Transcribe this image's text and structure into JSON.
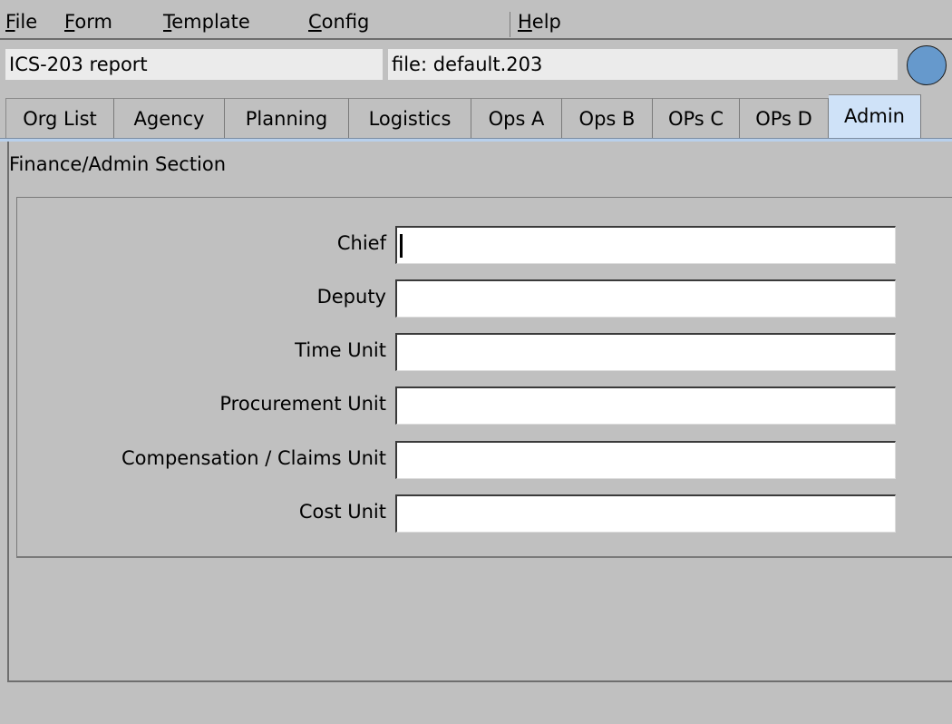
{
  "menubar": {
    "items": [
      {
        "mnemonic": "F",
        "rest": "ile"
      },
      {
        "mnemonic": "F",
        "rest": "orm"
      },
      {
        "mnemonic": "T",
        "rest": "emplate"
      },
      {
        "mnemonic": "C",
        "rest": "onfig"
      },
      {
        "mnemonic": "H",
        "rest": "elp"
      }
    ]
  },
  "header": {
    "report_name": "ICS-203 report",
    "file_label": "file: default.203",
    "status_color": "#6699cc"
  },
  "tabs": [
    {
      "label": "Org List"
    },
    {
      "label": "Agency"
    },
    {
      "label": "Planning"
    },
    {
      "label": "Logistics"
    },
    {
      "label": "Ops A"
    },
    {
      "label": "Ops B"
    },
    {
      "label": "OPs C"
    },
    {
      "label": "OPs D"
    },
    {
      "label": "Admin"
    }
  ],
  "selected_tab": "Admin",
  "section": {
    "title": "Finance/Admin Section",
    "fields": [
      {
        "label": "Chief",
        "value": ""
      },
      {
        "label": "Deputy",
        "value": ""
      },
      {
        "label": "Time Unit",
        "value": ""
      },
      {
        "label": "Procurement Unit",
        "value": ""
      },
      {
        "label": "Compensation / Claims Unit",
        "value": ""
      },
      {
        "label": "Cost Unit",
        "value": ""
      }
    ]
  },
  "colors": {
    "background": "#c0c0c0",
    "selected_tab": "#cfe2f8",
    "input_background": "#ffffff"
  }
}
